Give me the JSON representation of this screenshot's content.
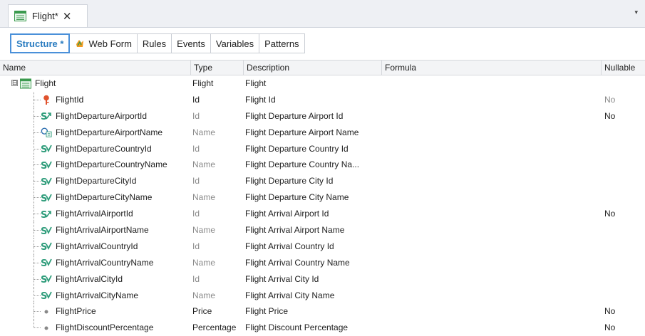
{
  "document_tab": {
    "title": "Flight",
    "modified": "*",
    "close": "✕",
    "icon": "transaction-icon"
  },
  "overflow_arrow": "▾",
  "subtabs": [
    {
      "label": "Structure *",
      "active": true
    },
    {
      "label": "Web Form",
      "icon": "web-form-icon"
    },
    {
      "label": "Rules"
    },
    {
      "label": "Events"
    },
    {
      "label": "Variables"
    },
    {
      "label": "Patterns"
    }
  ],
  "columns": {
    "name": "Name",
    "type": "Type",
    "description": "Description",
    "formula": "Formula",
    "nullable": "Nullable"
  },
  "root": {
    "expander": "⊟",
    "name": "Flight",
    "type": "Flight",
    "description": "Flight",
    "icon": "transaction-icon"
  },
  "rows": [
    {
      "name": "FlightId",
      "type": "Id",
      "description": "Flight Id",
      "nullable": "No",
      "icon": "key-icon",
      "type_grey": false,
      "nullable_grey": true
    },
    {
      "name": "FlightDepartureAirportId",
      "type": "Id",
      "description": "Flight Departure Airport Id",
      "nullable": "No",
      "icon": "foreign-key-icon",
      "type_grey": true
    },
    {
      "name": "FlightDepartureAirportName",
      "type": "Name",
      "description": "Flight Departure Airport Name",
      "nullable": "",
      "icon": "description-attribute-icon",
      "type_grey": true
    },
    {
      "name": "FlightDepartureCountryId",
      "type": "Id",
      "description": "Flight Departure Country Id",
      "nullable": "",
      "icon": "inferred-attribute-icon",
      "type_grey": true
    },
    {
      "name": "FlightDepartureCountryName",
      "type": "Name",
      "description": "Flight Departure Country Na...",
      "nullable": "",
      "icon": "inferred-attribute-icon",
      "type_grey": true
    },
    {
      "name": "FlightDepartureCityId",
      "type": "Id",
      "description": "Flight Departure City Id",
      "nullable": "",
      "icon": "inferred-attribute-icon",
      "type_grey": true
    },
    {
      "name": "FlightDepartureCityName",
      "type": "Name",
      "description": "Flight Departure City Name",
      "nullable": "",
      "icon": "inferred-attribute-icon",
      "type_grey": true
    },
    {
      "name": "FlightArrivalAirportId",
      "type": "Id",
      "description": "Flight Arrival Airport Id",
      "nullable": "No",
      "icon": "foreign-key-icon",
      "type_grey": true
    },
    {
      "name": "FlightArrivalAirportName",
      "type": "Name",
      "description": "Flight Arrival Airport Name",
      "nullable": "",
      "icon": "inferred-attribute-icon",
      "type_grey": true
    },
    {
      "name": "FlightArrivalCountryId",
      "type": "Id",
      "description": "Flight Arrival Country Id",
      "nullable": "",
      "icon": "inferred-attribute-icon",
      "type_grey": true
    },
    {
      "name": "FlightArrivalCountryName",
      "type": "Name",
      "description": "Flight Arrival Country Name",
      "nullable": "",
      "icon": "inferred-attribute-icon",
      "type_grey": true
    },
    {
      "name": "FlightArrivalCityId",
      "type": "Id",
      "description": "Flight Arrival City Id",
      "nullable": "",
      "icon": "inferred-attribute-icon",
      "type_grey": true
    },
    {
      "name": "FlightArrivalCityName",
      "type": "Name",
      "description": "Flight Arrival City Name",
      "nullable": "",
      "icon": "inferred-attribute-icon",
      "type_grey": true
    },
    {
      "name": "FlightPrice",
      "type": "Price",
      "description": "Flight Price",
      "nullable": "No",
      "icon": "attribute-dot-icon",
      "type_grey": false
    },
    {
      "name": "FlightDiscountPercentage",
      "type": "Percentage",
      "description": "Flight Discount Percentage",
      "nullable": "No",
      "icon": "attribute-dot-icon",
      "type_grey": false
    }
  ],
  "colors": {
    "accent": "#2a7cc0",
    "icon_green": "#2e9c7a",
    "key": "#e0522d",
    "grey_text": "#8a8a8a"
  }
}
